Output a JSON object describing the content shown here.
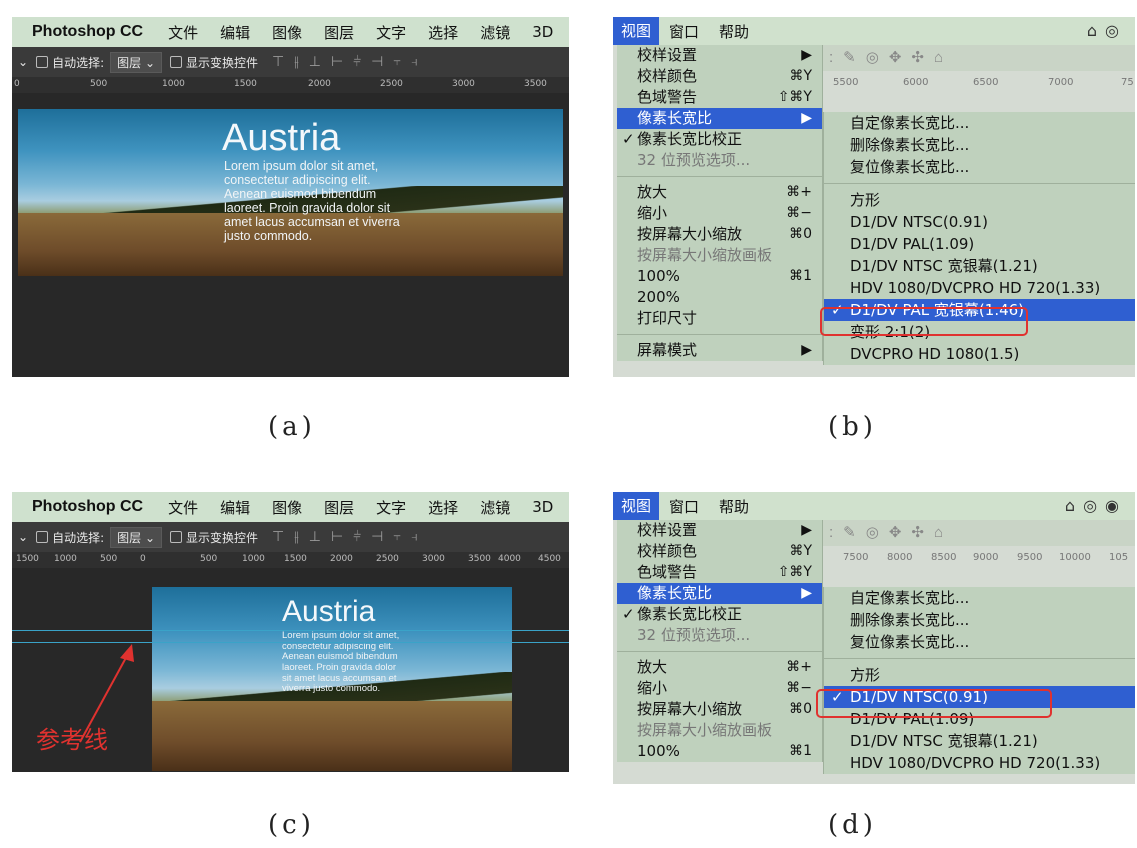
{
  "ps_menubar": {
    "brand": "Photoshop CC",
    "items": [
      "文件",
      "编辑",
      "图像",
      "图层",
      "文字",
      "选择",
      "滤镜",
      "3D"
    ]
  },
  "ps_options": {
    "auto_select_label": "自动选择:",
    "auto_select_value": "图层",
    "show_transform_label": "显示变换控件"
  },
  "panel_a": {
    "ruler_ticks": [
      "0",
      "500",
      "1000",
      "1500",
      "2000",
      "2500",
      "3000",
      "3500"
    ]
  },
  "panel_c": {
    "ruler_ticks": [
      "1500",
      "1000",
      "500",
      "0",
      "500",
      "1000",
      "1500",
      "2000",
      "2500",
      "3000",
      "3500",
      "4000",
      "4500"
    ],
    "annotation": "参考线"
  },
  "photo": {
    "title": "Austria",
    "body": "Lorem ipsum dolor sit amet, consectetur adipiscing elit. Aenean euismod bibendum laoreet. Proin gravida dolor sit amet lacus accumsan et viverra justo commodo."
  },
  "mac_menubar": {
    "items": [
      "视图",
      "窗口",
      "帮助"
    ]
  },
  "view_menu": {
    "items": [
      {
        "label": "校样设置",
        "shortcut": "▶"
      },
      {
        "label": "校样颜色",
        "shortcut": "⌘Y"
      },
      {
        "label": "色域警告",
        "shortcut": "⇧⌘Y"
      },
      {
        "label": "像素长宽比",
        "shortcut": "▶"
      },
      {
        "label": "像素长宽比校正",
        "shortcut": "",
        "checked": "✓"
      },
      {
        "label": "32 位预览选项...",
        "shortcut": ""
      },
      {
        "label": "放大",
        "shortcut": "⌘+"
      },
      {
        "label": "缩小",
        "shortcut": "⌘−"
      },
      {
        "label": "按屏幕大小缩放",
        "shortcut": "⌘0"
      },
      {
        "label": "按屏幕大小缩放画板",
        "shortcut": ""
      },
      {
        "label": "100%",
        "shortcut": "⌘1"
      },
      {
        "label": "200%",
        "shortcut": ""
      },
      {
        "label": "打印尺寸",
        "shortcut": ""
      },
      {
        "label": "屏幕模式",
        "shortcut": "▶"
      }
    ]
  },
  "pixel_aspect_submenu": {
    "items": [
      "自定像素长宽比...",
      "删除像素长宽比...",
      "复位像素长宽比...",
      "方形",
      "D1/DV NTSC(0.91)",
      "D1/DV PAL(1.09)",
      "D1/DV NTSC 宽银幕(1.21)",
      "HDV 1080/DVCPRO HD 720(1.33)",
      "D1/DV PAL 宽银幕(1.46)",
      "变形 2:1(2)",
      "DVCPRO HD 1080(1.5)"
    ],
    "check": "✓"
  },
  "panel_b": {
    "ruler_ticks": [
      "5500",
      "6000",
      "6500",
      "7000",
      "75"
    ]
  },
  "panel_d": {
    "ruler_ticks": [
      "7500",
      "8000",
      "8500",
      "9000",
      "9500",
      "10000",
      "105"
    ]
  },
  "captions": [
    "(a)",
    "(b)",
    "(c)",
    "(d)"
  ]
}
